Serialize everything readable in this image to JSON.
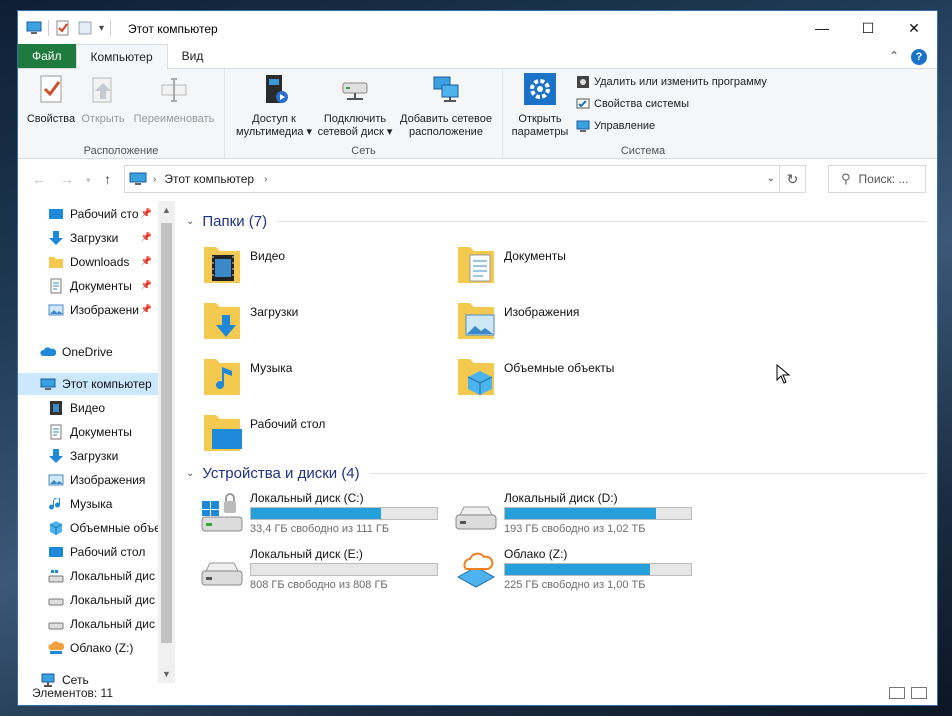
{
  "window": {
    "title": "Этот компьютер"
  },
  "ribbon": {
    "tabs": [
      "Файл",
      "Компьютер",
      "Вид"
    ],
    "groups": {
      "location": {
        "label": "Расположение",
        "buttons": [
          "Свойства",
          "Открыть",
          "Переименовать"
        ]
      },
      "network": {
        "label": "Сеть",
        "buttons": [
          {
            "line1": "Доступ к",
            "line2": "мультимедиа"
          },
          {
            "line1": "Подключить",
            "line2": "сетевой диск"
          },
          {
            "line1": "Добавить сетевое",
            "line2": "расположение"
          }
        ]
      },
      "system": {
        "label": "Система",
        "big": {
          "line1": "Открыть",
          "line2": "параметры"
        },
        "small": [
          "Удалить или изменить программу",
          "Свойства системы",
          "Управление"
        ]
      }
    }
  },
  "address": {
    "crumb": "Этот компьютер",
    "search_placeholder": "Поиск: ..."
  },
  "nav": {
    "quick": [
      {
        "label": "Рабочий сто",
        "icon": "desktop-icon"
      },
      {
        "label": "Загрузки",
        "icon": "download-icon"
      },
      {
        "label": "Downloads",
        "icon": "folder-icon"
      },
      {
        "label": "Документы",
        "icon": "documents-icon"
      },
      {
        "label": "Изображени",
        "icon": "pictures-icon"
      }
    ],
    "onedrive": "OneDrive",
    "this_pc": "Этот компьютер",
    "pc_items": [
      {
        "label": "Видео",
        "icon": "video-icon"
      },
      {
        "label": "Документы",
        "icon": "documents-icon"
      },
      {
        "label": "Загрузки",
        "icon": "download-icon"
      },
      {
        "label": "Изображения",
        "icon": "pictures-icon"
      },
      {
        "label": "Музыка",
        "icon": "music-icon"
      },
      {
        "label": "Объемные объе",
        "icon": "3d-objects-icon"
      },
      {
        "label": "Рабочий стол",
        "icon": "desktop-icon"
      },
      {
        "label": "Локальный дис",
        "icon": "drive-windows-icon"
      },
      {
        "label": "Локальный дис",
        "icon": "drive-icon"
      },
      {
        "label": "Локальный дис",
        "icon": "drive-icon"
      },
      {
        "label": "Облако (Z:)",
        "icon": "cloud-drive-icon"
      }
    ],
    "network": "Сеть"
  },
  "content": {
    "folders_header": "Папки (7)",
    "folders": [
      {
        "name": "Видео",
        "icon": "video-folder-icon"
      },
      {
        "name": "Документы",
        "icon": "documents-folder-icon"
      },
      {
        "name": "Загрузки",
        "icon": "downloads-folder-icon"
      },
      {
        "name": "Изображения",
        "icon": "pictures-folder-icon"
      },
      {
        "name": "Музыка",
        "icon": "music-folder-icon"
      },
      {
        "name": "Объемные объекты",
        "icon": "3d-objects-folder-icon"
      },
      {
        "name": "Рабочий стол",
        "icon": "desktop-folder-icon"
      }
    ],
    "drives_header": "Устройства и диски (4)",
    "drives": [
      {
        "name": "Локальный диск (C:)",
        "info": "33,4 ГБ свободно из 111 ГБ",
        "used_fraction": 0.7,
        "icon": "windows-drive-icon"
      },
      {
        "name": "Локальный диск (D:)",
        "info": "193 ГБ свободно из 1,02 ТБ",
        "used_fraction": 0.81,
        "icon": "drive-icon"
      },
      {
        "name": "Локальный диск (E:)",
        "info": "808 ГБ свободно из 808 ГБ",
        "used_fraction": 0.0,
        "icon": "drive-icon"
      },
      {
        "name": "Облако (Z:)",
        "info": "225 ГБ свободно из 1,00 ТБ",
        "used_fraction": 0.78,
        "icon": "cloud-drive-icon"
      }
    ]
  },
  "status": {
    "count": "Элементов: 11"
  },
  "colors": {
    "accent": "#1e7a3e",
    "selection": "#cce8ff",
    "bar_fill": "#26a0da",
    "header_text": "#1e3287"
  }
}
